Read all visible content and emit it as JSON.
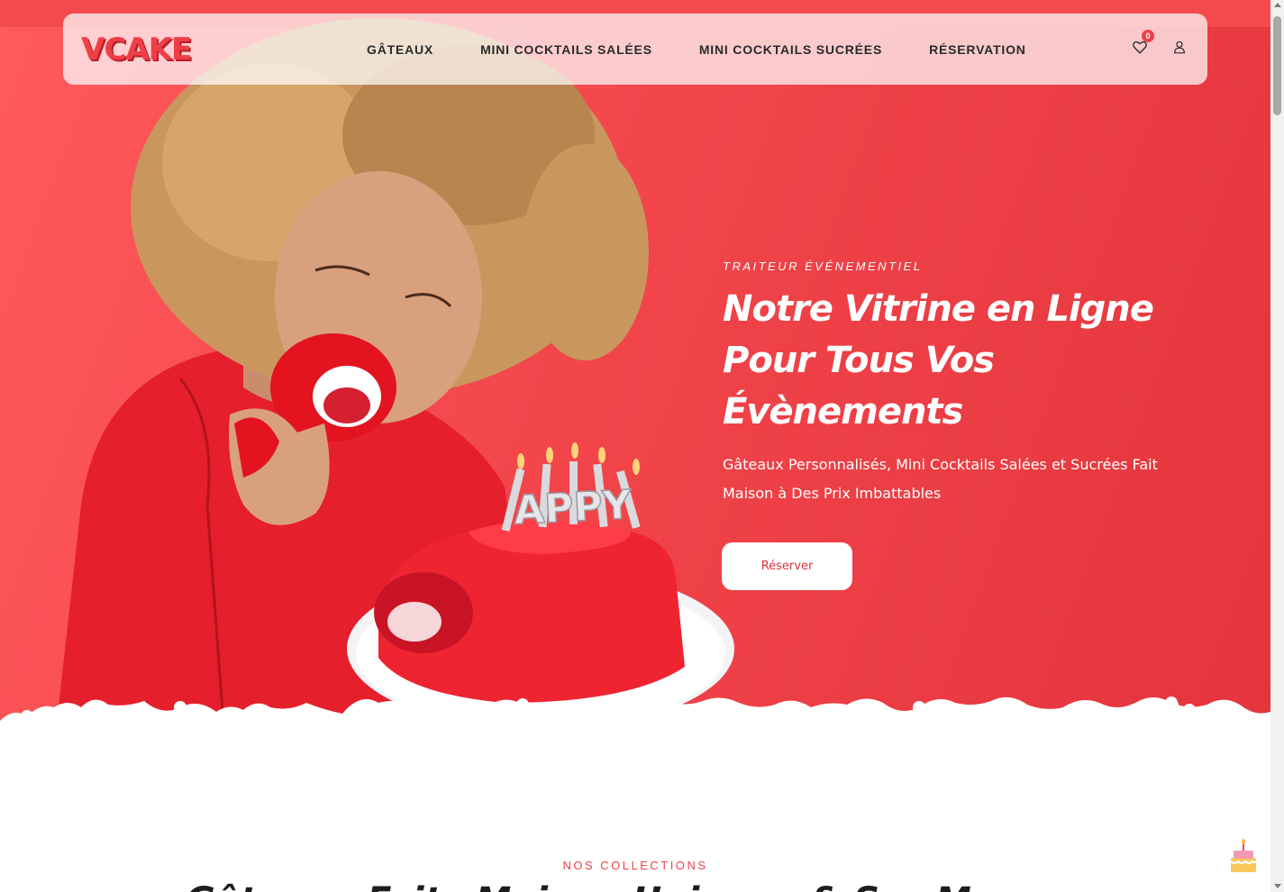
{
  "brand": {
    "logo_text": "VCAKE"
  },
  "nav": {
    "items": [
      {
        "label": "GÂTEAUX"
      },
      {
        "label": "MINI COCKTAILS SALÉES"
      },
      {
        "label": "MINI COCKTAILS SUCRÉES"
      },
      {
        "label": "RÉSERVATION"
      }
    ]
  },
  "header_icons": {
    "wishlist_count": "0",
    "wishlist_icon": "heart-icon",
    "account_icon": "user-icon"
  },
  "hero": {
    "eyebrow": "TRAITEUR ÉVÉNEMENTIEL",
    "headline": "Notre Vitrine en Ligne Pour Tous Vos Évènements",
    "subtitle": "Gâteaux Personnalisés, Mini Cocktails Salées et Sucrées Fait Maison à Des Prix Imbattables",
    "cta_label": "Réserver",
    "candle_text": "APPY"
  },
  "collections": {
    "label": "NOS COLLECTIONS",
    "title": "Gâteaux Faits Maison Uniques & Sur Mesure"
  },
  "colors": {
    "accent": "#ef3f47",
    "hero_bg": "#f2464b"
  }
}
